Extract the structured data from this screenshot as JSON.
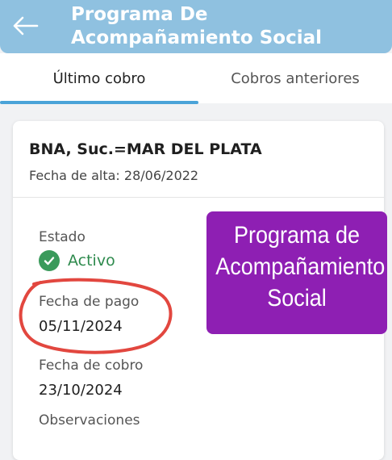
{
  "header": {
    "title": "Programa De Acompañamiento Social",
    "back_icon": "arrow-left-icon"
  },
  "tabs": [
    {
      "label": "Último cobro",
      "active": true
    },
    {
      "label": "Cobros anteriores",
      "active": false
    }
  ],
  "card": {
    "bank": "BNA, Suc.=MAR DEL PLATA",
    "alta": "Fecha de alta: 28/06/2022",
    "estado_label": "Estado",
    "estado_value": "Activo",
    "pago_label": "Fecha de pago",
    "pago_value": "05/11/2024",
    "cobro_label": "Fecha de cobro",
    "cobro_value": "23/10/2024",
    "obs_label": "Observaciones"
  },
  "overlay": {
    "text": "Programa de Acompañamiento Social"
  },
  "colors": {
    "appbar": "#8fc1e0",
    "tab_indicator": "#4aa3d8",
    "status_green": "#2e8a4d",
    "overlay_purple": "#8e1fb3",
    "annotation_red": "#e2473f"
  }
}
